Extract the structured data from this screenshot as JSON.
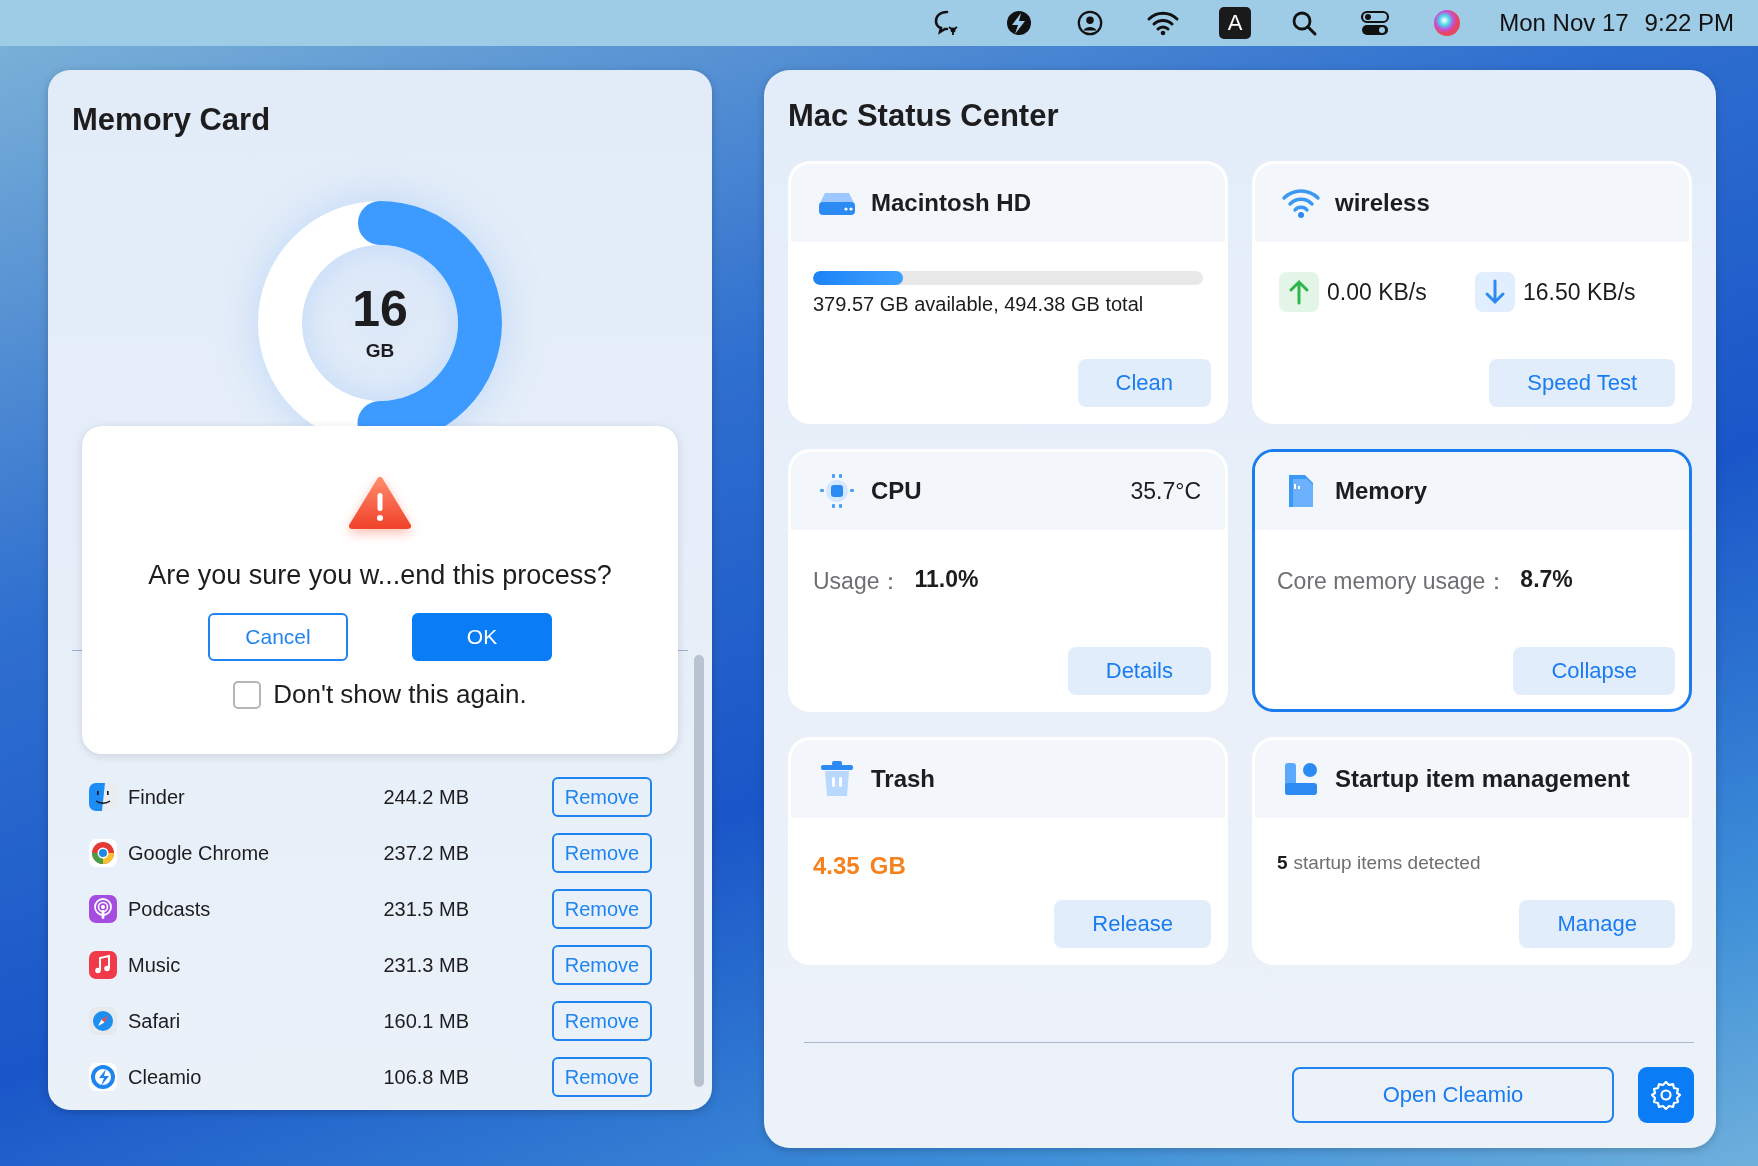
{
  "menu_bar": {
    "input_source": "A",
    "date": "Mon Nov 17",
    "time": "9:22 PM"
  },
  "memory_card": {
    "title": "Memory Card",
    "ring": {
      "value": "16",
      "unit": "GB",
      "level": 0.5
    },
    "processes": [
      {
        "name": "Finder",
        "size": "244.2 MB",
        "action": "Remove"
      },
      {
        "name": "Google Chrome",
        "size": "237.2 MB",
        "action": "Remove"
      },
      {
        "name": "Podcasts",
        "size": "231.5 MB",
        "action": "Remove"
      },
      {
        "name": "Music",
        "size": "231.3 MB",
        "action": "Remove"
      },
      {
        "name": "Safari",
        "size": "160.1 MB",
        "action": "Remove"
      },
      {
        "name": "Cleamio",
        "size": "106.8 MB",
        "action": "Remove"
      }
    ]
  },
  "dialog": {
    "message": "Are you sure you w...end this process?",
    "buttons": [
      {
        "kind": "secondary",
        "label": "Cancel"
      },
      {
        "kind": "primary",
        "label": "OK"
      }
    ],
    "checkbox": {
      "label": "Don't show this again.",
      "checked": false
    }
  },
  "status_center": {
    "title": "Mac Status Center",
    "cards": [
      {
        "kind": "disk",
        "title": "Macintosh HD",
        "selected": false,
        "level": 0.23,
        "caption": "379.57 GB available, 494.38 GB total",
        "button": "Clean"
      },
      {
        "kind": "network",
        "title": "wireless",
        "selected": false,
        "upload": "0.00 KB/s",
        "download": "16.50 KB/s",
        "button": "Speed Test"
      },
      {
        "kind": "cpu",
        "title": "CPU",
        "selected": false,
        "temperature": "35.7°C",
        "label": "Usage：",
        "value": "11.0%",
        "button": "Details"
      },
      {
        "kind": "memory",
        "title": "Memory",
        "selected": true,
        "label": "Core memory usage：",
        "value": "8.7%",
        "button": "Collapse"
      },
      {
        "kind": "trash",
        "title": "Trash",
        "selected": false,
        "amount": "4.35",
        "unit": "GB",
        "button": "Release"
      },
      {
        "kind": "startup",
        "title": "Startup item management",
        "selected": false,
        "count": "5",
        "caption": "startup items detected",
        "button": "Manage"
      }
    ],
    "open_button": "Open Cleamio"
  }
}
